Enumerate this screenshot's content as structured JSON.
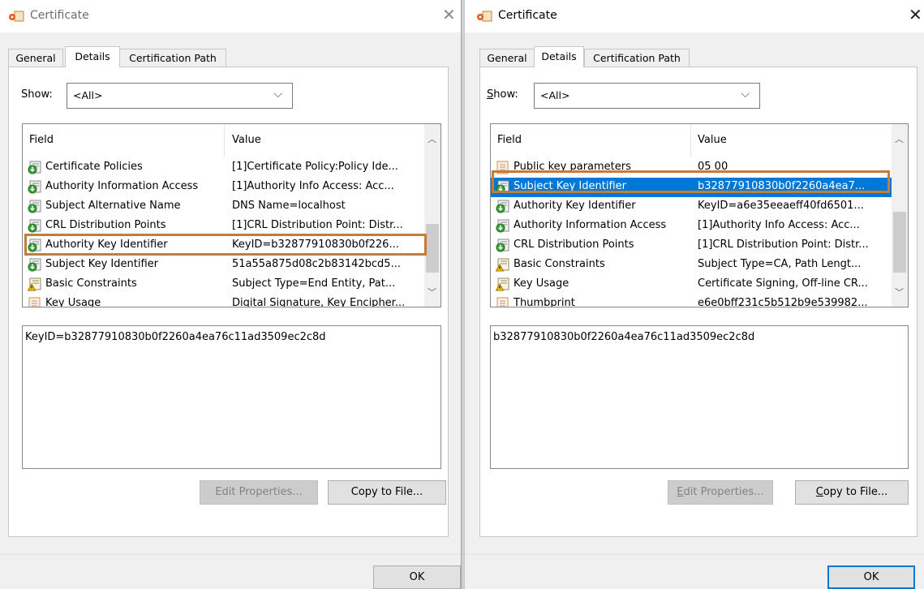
{
  "left": {
    "title": "Certificate",
    "tabs": [
      "General",
      "Details",
      "Certification Path"
    ],
    "show_label": "Show:",
    "show_value": "<All>",
    "columns": {
      "field": "Field",
      "value": "Value"
    },
    "rows": [
      {
        "field": "Certificate Policies",
        "value": "[1]Certificate Policy:Policy Ide...",
        "icon": "cert-ext-icon"
      },
      {
        "field": "Authority Information Access",
        "value": "[1]Authority Info Access: Acc...",
        "icon": "cert-ext-icon"
      },
      {
        "field": "Subject Alternative Name",
        "value": "DNS Name=localhost",
        "icon": "cert-ext-icon"
      },
      {
        "field": "CRL Distribution Points",
        "value": "[1]CRL Distribution Point: Distr...",
        "icon": "cert-ext-icon"
      },
      {
        "field": "Authority Key Identifier",
        "value": "KeyID=b32877910830b0f226...",
        "icon": "cert-ext-icon"
      },
      {
        "field": "Subject Key Identifier",
        "value": "51a55a875d08c2b83142bcd5...",
        "icon": "cert-ext-icon"
      },
      {
        "field": "Basic Constraints",
        "value": "Subject Type=End Entity, Pat...",
        "icon": "cert-warning-icon"
      },
      {
        "field": "Key Usage",
        "value": "Digital Signature, Key Encipher...",
        "icon": "cert-field-icon"
      }
    ],
    "detail_value": "KeyID=b32877910830b0f2260a4ea76c11ad3509ec2c8d",
    "edit_button": "Edit Properties...",
    "copy_button": "Copy to File...",
    "ok_button": "OK"
  },
  "right": {
    "title": "Certificate",
    "tabs": [
      "General",
      "Details",
      "Certification Path"
    ],
    "show_label": "Show:",
    "show_value": "<All>",
    "columns": {
      "field": "Field",
      "value": "Value"
    },
    "rows": [
      {
        "field": "Public key parameters",
        "value": "05 00",
        "icon": "cert-field-icon"
      },
      {
        "field": "Subject Key Identifier",
        "value": "b32877910830b0f2260a4ea7...",
        "icon": "cert-ext-icon"
      },
      {
        "field": "Authority Key Identifier",
        "value": "KeyID=a6e35eeaeff40fd6501...",
        "icon": "cert-ext-icon"
      },
      {
        "field": "Authority Information Access",
        "value": "[1]Authority Info Access: Acc...",
        "icon": "cert-ext-icon"
      },
      {
        "field": "CRL Distribution Points",
        "value": "[1]CRL Distribution Point: Distr...",
        "icon": "cert-ext-icon"
      },
      {
        "field": "Basic Constraints",
        "value": "Subject Type=CA, Path Lengt...",
        "icon": "cert-warning-icon"
      },
      {
        "field": "Key Usage",
        "value": "Certificate Signing, Off-line CR...",
        "icon": "cert-warning-icon"
      },
      {
        "field": "Thumbprint",
        "value": "e6e0bff231c5b512b9e539982...",
        "icon": "cert-field-icon"
      }
    ],
    "detail_value": "b32877910830b0f2260a4ea76c11ad3509ec2c8d",
    "edit_button": "Edit Properties...",
    "copy_button": "Copy to File...",
    "ok_button": "OK"
  },
  "colors": {
    "selection": "#0078d7",
    "highlight": "#c47c39"
  }
}
